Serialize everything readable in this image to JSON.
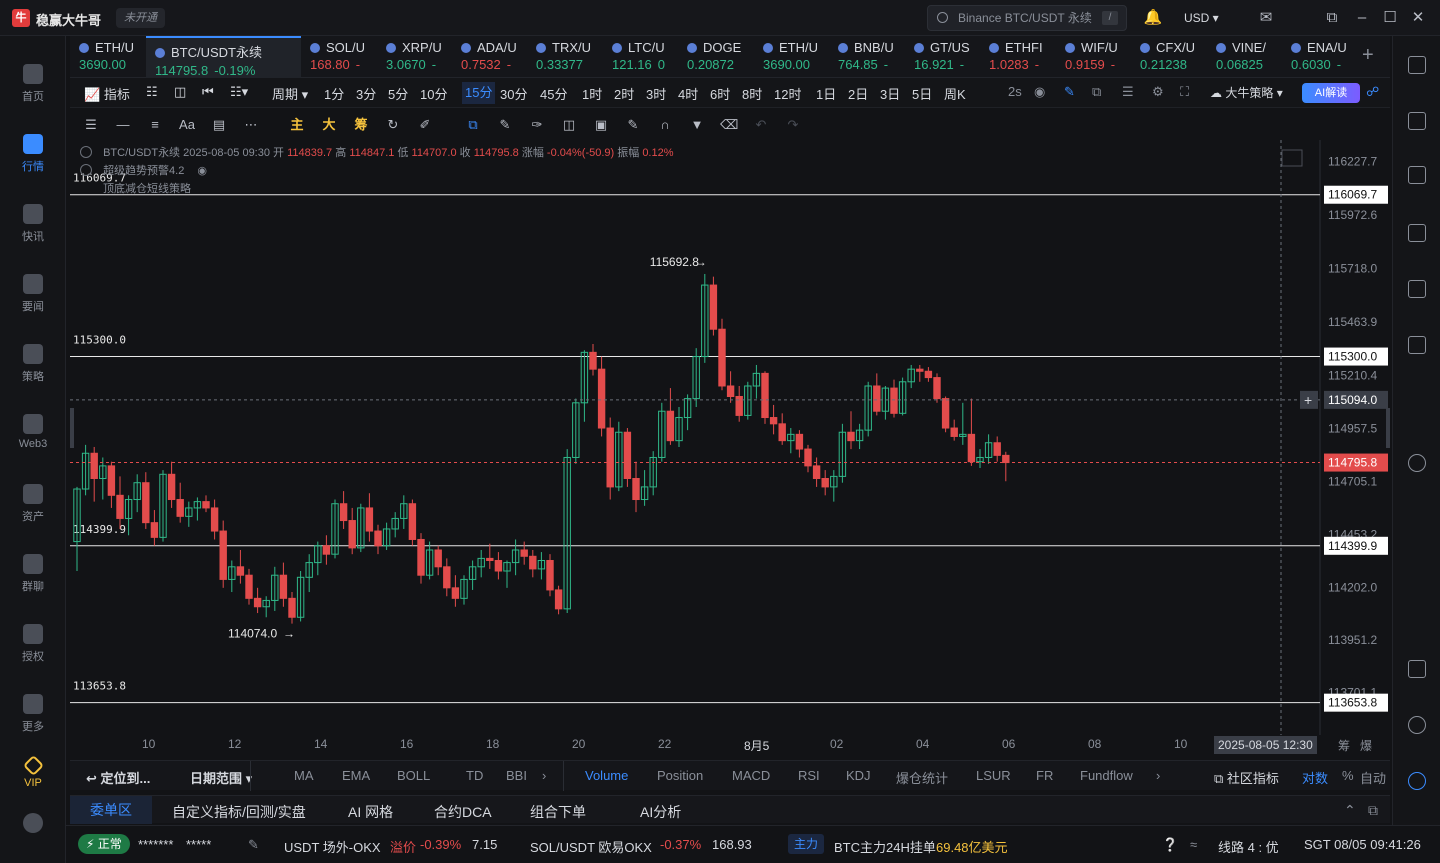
{
  "app": {
    "name": "稳赢大牛哥",
    "logo_text": "牛",
    "unopened": "未开通"
  },
  "search": {
    "placeholder": "Binance BTC/USDT 永续",
    "shortcut": "/"
  },
  "currency": "USD ▾",
  "nav": [
    {
      "label": "首页",
      "icon": "home-icon"
    },
    {
      "label": "行情",
      "icon": "market-icon",
      "active": true
    },
    {
      "label": "快讯",
      "icon": "flash-news-icon"
    },
    {
      "label": "要闻",
      "icon": "news-icon"
    },
    {
      "label": "策略",
      "icon": "strategy-icon"
    },
    {
      "label": "Web3",
      "icon": "web3-icon"
    },
    {
      "label": "资产",
      "icon": "wallet-icon"
    },
    {
      "label": "群聊",
      "icon": "chat-icon"
    },
    {
      "label": "授权",
      "icon": "key-icon"
    },
    {
      "label": "更多",
      "icon": "more-icon"
    },
    {
      "label": "VIP",
      "icon": "vip-icon",
      "vip": true
    }
  ],
  "tickers": [
    {
      "name": "ETH/U",
      "price": "3690.00",
      "change": "",
      "dir": "up",
      "x": 0,
      "w": 76
    },
    {
      "name": "BTC/USDT永续",
      "price": "114795.8",
      "change": "-0.19%",
      "dir": "up",
      "x": 76,
      "w": 155,
      "active": true
    },
    {
      "name": "SOL/U",
      "price": "168.80",
      "change": "-",
      "dir": "down",
      "x": 231,
      "w": 76
    },
    {
      "name": "XRP/U",
      "price": "3.0670",
      "change": "-",
      "dir": "up",
      "x": 307,
      "w": 75
    },
    {
      "name": "ADA/U",
      "price": "0.7532",
      "change": "-",
      "dir": "down",
      "x": 382,
      "w": 75
    },
    {
      "name": "TRX/U",
      "price": "0.33377",
      "change": "",
      "dir": "up",
      "x": 457,
      "w": 76
    },
    {
      "name": "LTC/U",
      "price": "121.16",
      "change": "0",
      "dir": "up",
      "x": 533,
      "w": 75
    },
    {
      "name": "DOGE",
      "price": "0.20872",
      "change": "",
      "dir": "up",
      "x": 608,
      "w": 76
    },
    {
      "name": "ETH/U",
      "price": "3690.00",
      "change": "",
      "dir": "up",
      "x": 684,
      "w": 75
    },
    {
      "name": "BNB/U",
      "price": "764.85",
      "change": "-",
      "dir": "up",
      "x": 759,
      "w": 76
    },
    {
      "name": "GT/US",
      "price": "16.921",
      "change": "-",
      "dir": "up",
      "x": 835,
      "w": 75
    },
    {
      "name": "ETHFI",
      "price": "1.0283",
      "change": "-",
      "dir": "down",
      "x": 910,
      "w": 76
    },
    {
      "name": "WIF/U",
      "price": "0.9159",
      "change": "-",
      "dir": "down",
      "x": 986,
      "w": 75
    },
    {
      "name": "CFX/U",
      "price": "0.21238",
      "change": "",
      "dir": "up",
      "x": 1061,
      "w": 76
    },
    {
      "name": "VINE/",
      "price": "0.06825",
      "change": "",
      "dir": "up",
      "x": 1137,
      "w": 75
    },
    {
      "name": "ENA/U",
      "price": "0.6030",
      "change": "-",
      "dir": "up",
      "x": 1212,
      "w": 76
    }
  ],
  "toolbar": {
    "indicator": "指标",
    "period": "周期",
    "periods": [
      "1分",
      "3分",
      "5分",
      "10分",
      "15分",
      "30分",
      "45分",
      "1时",
      "2时",
      "3时",
      "4时",
      "6时",
      "8时",
      "12时",
      "1日",
      "2日",
      "3日",
      "5日",
      "周K"
    ],
    "selected_period": "15分",
    "refresh": "2s",
    "strategy": "大牛策略",
    "ai": "AI解读"
  },
  "drawtools": {
    "main": "主",
    "big": "大",
    "chip": "筹"
  },
  "legend": {
    "symbol": "BTC/USDT永续",
    "datetime": "2025-08-05 09:30",
    "open_label": "开",
    "open": "114839.7",
    "high_label": "高",
    "high": "114847.1",
    "low_label": "低",
    "low": "114707.0",
    "close_label": "收",
    "close": "114795.8",
    "chg_label": "涨幅",
    "chg": "-0.04%(-50.9)",
    "amp_label": "振幅",
    "amp": "0.12%",
    "ind1": "超级趋势预警4.2",
    "ind2": "顶底减仓短线策略"
  },
  "chart_data": {
    "type": "candlestick",
    "ylim": [
      113500,
      116330
    ],
    "y_ticks": [
      "116227.7",
      "115972.6",
      "115718.0",
      "115463.9",
      "115210.4",
      "114957.5",
      "114705.1",
      "114453.2",
      "114202.0",
      "113951.2",
      "113701.1"
    ],
    "x_ticks": [
      "10",
      "12",
      "14",
      "16",
      "18",
      "20",
      "22",
      "8月5",
      "02",
      "04",
      "06",
      "08",
      "10"
    ],
    "hlines": [
      {
        "value": 116069.7,
        "label": "116069.7"
      },
      {
        "value": 115300.0,
        "label": "115300.0"
      },
      {
        "value": 114399.9,
        "label": "114399.9"
      },
      {
        "value": 113653.8,
        "label": "113653.8"
      }
    ],
    "last_price": {
      "value": 114795.8,
      "label": "114795.8"
    },
    "crosshair": {
      "value": 115094.0,
      "label": "115094.0",
      "time": "2025-08-05 12:30"
    },
    "max_label": "115692.8",
    "min_label": "114074.0",
    "candles": [
      [
        114420,
        114680,
        114280,
        114670
      ],
      [
        114670,
        114880,
        114640,
        114840
      ],
      [
        114840,
        114870,
        114610,
        114720
      ],
      [
        114720,
        114820,
        114620,
        114780
      ],
      [
        114780,
        114800,
        114580,
        114640
      ],
      [
        114640,
        114730,
        114480,
        114530
      ],
      [
        114530,
        114640,
        114450,
        114620
      ],
      [
        114620,
        114740,
        114560,
        114700
      ],
      [
        114700,
        114750,
        114480,
        114510
      ],
      [
        114510,
        114570,
        114400,
        114440
      ],
      [
        114440,
        114760,
        114420,
        114740
      ],
      [
        114740,
        114800,
        114580,
        114620
      ],
      [
        114620,
        114700,
        114510,
        114540
      ],
      [
        114540,
        114610,
        114490,
        114580
      ],
      [
        114580,
        114630,
        114520,
        114610
      ],
      [
        114610,
        114640,
        114560,
        114580
      ],
      [
        114580,
        114620,
        114430,
        114470
      ],
      [
        114470,
        114520,
        114200,
        114240
      ],
      [
        114240,
        114330,
        114180,
        114300
      ],
      [
        114300,
        114380,
        114220,
        114260
      ],
      [
        114260,
        114290,
        114120,
        114150
      ],
      [
        114150,
        114200,
        114080,
        114110
      ],
      [
        114110,
        114160,
        114060,
        114140
      ],
      [
        114140,
        114300,
        114090,
        114260
      ],
      [
        114260,
        114320,
        114110,
        114150
      ],
      [
        114150,
        114180,
        114030,
        114060
      ],
      [
        114060,
        114280,
        114040,
        114250
      ],
      [
        114250,
        114360,
        114180,
        114320
      ],
      [
        114320,
        114420,
        114260,
        114400
      ],
      [
        114400,
        114450,
        114310,
        114360
      ],
      [
        114360,
        114620,
        114340,
        114600
      ],
      [
        114600,
        114660,
        114480,
        114520
      ],
      [
        114520,
        114580,
        114360,
        114390
      ],
      [
        114390,
        114600,
        114370,
        114580
      ],
      [
        114580,
        114650,
        114420,
        114470
      ],
      [
        114470,
        114500,
        114360,
        114400
      ],
      [
        114400,
        114510,
        114380,
        114480
      ],
      [
        114480,
        114560,
        114440,
        114530
      ],
      [
        114530,
        114640,
        114480,
        114600
      ],
      [
        114600,
        114620,
        114400,
        114430
      ],
      [
        114430,
        114460,
        114220,
        114260
      ],
      [
        114260,
        114420,
        114240,
        114380
      ],
      [
        114380,
        114400,
        114260,
        114300
      ],
      [
        114300,
        114340,
        114160,
        114200
      ],
      [
        114200,
        114260,
        114110,
        114150
      ],
      [
        114150,
        114260,
        114120,
        114240
      ],
      [
        114240,
        114330,
        114190,
        114300
      ],
      [
        114300,
        114380,
        114250,
        114340
      ],
      [
        114340,
        114410,
        114290,
        114330
      ],
      [
        114330,
        114370,
        114240,
        114280
      ],
      [
        114280,
        114330,
        114200,
        114320
      ],
      [
        114320,
        114430,
        114260,
        114380
      ],
      [
        114380,
        114420,
        114310,
        114350
      ],
      [
        114350,
        114380,
        114250,
        114290
      ],
      [
        114290,
        114370,
        114240,
        114330
      ],
      [
        114330,
        114360,
        114160,
        114190
      ],
      [
        114190,
        114210,
        114074,
        114100
      ],
      [
        114100,
        114860,
        114080,
        114820
      ],
      [
        114820,
        115100,
        114790,
        115080
      ],
      [
        115080,
        115330,
        114990,
        115320
      ],
      [
        115320,
        115360,
        115210,
        115240
      ],
      [
        115240,
        115300,
        114920,
        114960
      ],
      [
        114960,
        115010,
        114620,
        114680
      ],
      [
        114680,
        114990,
        114660,
        114940
      ],
      [
        114940,
        114960,
        114680,
        114720
      ],
      [
        114720,
        114800,
        114560,
        114620
      ],
      [
        114620,
        114760,
        114590,
        114680
      ],
      [
        114680,
        114850,
        114640,
        114820
      ],
      [
        114820,
        115080,
        114800,
        115040
      ],
      [
        115040,
        115150,
        114880,
        114900
      ],
      [
        114900,
        115060,
        114870,
        115010
      ],
      [
        115010,
        115120,
        114950,
        115100
      ],
      [
        115100,
        115340,
        115060,
        115300
      ],
      [
        115300,
        115692.8,
        115270,
        115640
      ],
      [
        115640,
        115680,
        115400,
        115430
      ],
      [
        115430,
        115480,
        115140,
        115160
      ],
      [
        115160,
        115230,
        115080,
        115110
      ],
      [
        115110,
        115160,
        114990,
        115020
      ],
      [
        115020,
        115180,
        115000,
        115160
      ],
      [
        115160,
        115260,
        115100,
        115220
      ],
      [
        115220,
        115230,
        114980,
        115010
      ],
      [
        115010,
        115070,
        114930,
        114980
      ],
      [
        114980,
        115030,
        114880,
        114900
      ],
      [
        114900,
        114960,
        114840,
        114930
      ],
      [
        114930,
        114950,
        114820,
        114860
      ],
      [
        114860,
        114880,
        114750,
        114780
      ],
      [
        114780,
        114820,
        114680,
        114720
      ],
      [
        114720,
        114760,
        114640,
        114680
      ],
      [
        114680,
        114760,
        114610,
        114730
      ],
      [
        114730,
        114980,
        114700,
        114940
      ],
      [
        114940,
        115040,
        114860,
        114900
      ],
      [
        114900,
        114980,
        114860,
        114950
      ],
      [
        114950,
        115180,
        114920,
        115160
      ],
      [
        115160,
        115220,
        115020,
        115040
      ],
      [
        115040,
        115160,
        115000,
        115150
      ],
      [
        115150,
        115190,
        115010,
        115030
      ],
      [
        115030,
        115200,
        115020,
        115180
      ],
      [
        115180,
        115260,
        115150,
        115240
      ],
      [
        115240,
        115260,
        115180,
        115230
      ],
      [
        115230,
        115250,
        115180,
        115200
      ],
      [
        115200,
        115220,
        115080,
        115100
      ],
      [
        115100,
        115110,
        114940,
        114960
      ],
      [
        114960,
        115000,
        114900,
        114920
      ],
      [
        114920,
        115080,
        114880,
        114930
      ],
      [
        114930,
        115100,
        114780,
        114800
      ],
      [
        114800,
        114860,
        114770,
        114820
      ],
      [
        114820,
        114930,
        114790,
        114890
      ],
      [
        114890,
        114920,
        114800,
        114830
      ],
      [
        114830,
        114847.1,
        114707.0,
        114795.8
      ]
    ]
  },
  "indicators": {
    "locate": "定位到...",
    "range": "日期范围 ▾",
    "items": [
      "MA",
      "EMA",
      "BOLL",
      "TD",
      "BBI",
      "Volume",
      "Position",
      "MACD",
      "RSI",
      "KDJ",
      "爆仓统计",
      "LSUR",
      "FR",
      "Fundflow"
    ],
    "selected": "Volume",
    "community": "社区指标",
    "log": "对数",
    "pct": "%",
    "auto": "自动"
  },
  "orders": {
    "tabs": [
      "委单区",
      "自定义指标/回测/实盘",
      "AI 网格",
      "合约DCA",
      "组合下单",
      "AI分析"
    ],
    "selected": "委单区"
  },
  "status": {
    "normal": "正常",
    "user": "*******",
    "pwd": "*****",
    "usdt_label": "USDT 场外-OKX",
    "premium_label": "溢价",
    "premium": "-0.39%",
    "premium_val": "7.15",
    "sol_label": "SOL/USDT 欧易OKX",
    "sol_chg": "-0.37%",
    "sol_price": "168.93",
    "zhuli": "主力",
    "btc_label": "BTC主力24H挂单",
    "btc_val": "69.48亿美元",
    "line": "线路 4 : 优",
    "clock": "SGT 08/05 09:41:26"
  },
  "colors": {
    "up": "#30b889",
    "down": "#e34c4c",
    "accent": "#3b8cff"
  }
}
